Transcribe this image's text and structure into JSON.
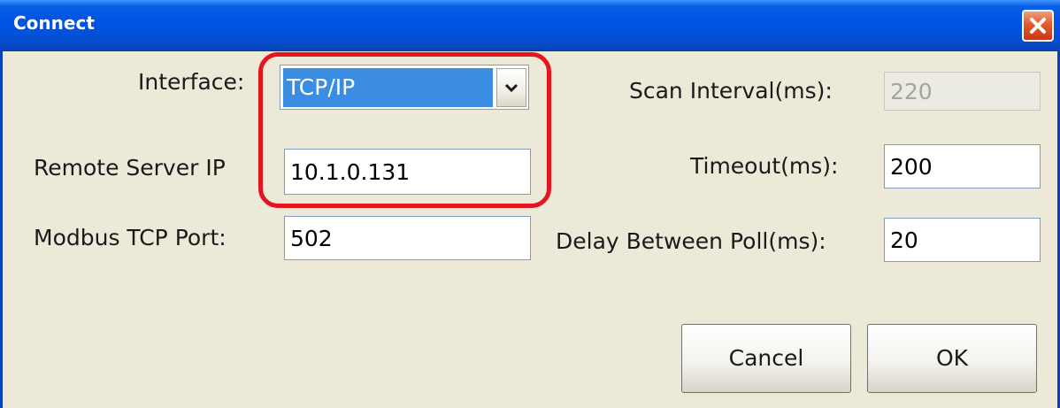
{
  "window": {
    "title": "Connect",
    "close_icon": "close-x-icon"
  },
  "form": {
    "interface_label": "Interface:",
    "interface_value": "TCP/IP",
    "interface_dropdown_icon": "chevron-down-icon",
    "remote_ip_label": "Remote Server IP",
    "remote_ip_value": "10.1.0.131",
    "port_label": "Modbus TCP Port:",
    "port_value": "502",
    "scan_interval_label": "Scan Interval(ms):",
    "scan_interval_value": "220",
    "timeout_label": "Timeout(ms):",
    "timeout_value": "200",
    "delay_label": "Delay Between Poll(ms):",
    "delay_value": "20"
  },
  "buttons": {
    "cancel_label": "Cancel",
    "ok_label": "OK"
  },
  "colors": {
    "titlebar": "#0054e3",
    "selection": "#3a8de0",
    "annotation": "#e4151e",
    "close_button": "#e25a2a"
  }
}
